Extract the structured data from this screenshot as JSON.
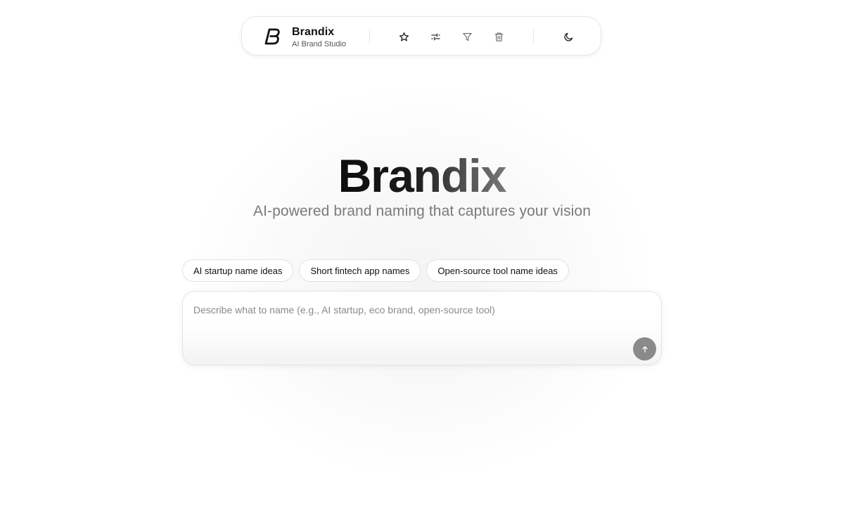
{
  "navbar": {
    "brand_name": "Brandix",
    "brand_subtitle": "AI Brand Studio",
    "logo_letter": "B",
    "icons": [
      "star-icon",
      "sliders-icon",
      "filter-icon",
      "trash-icon",
      "moon-icon"
    ]
  },
  "hero": {
    "title": "Brandix",
    "subtitle": "AI-powered brand naming that captures your vision"
  },
  "suggestions": [
    {
      "label": "AI startup name ideas"
    },
    {
      "label": "Short fintech app names"
    },
    {
      "label": "Open-source tool name ideas"
    }
  ],
  "prompt": {
    "placeholder": "Describe what to name (e.g., AI startup, eco brand, open-source tool)",
    "value": "",
    "send_icon": "arrow-up-icon"
  },
  "colors": {
    "accent": "#111111",
    "send_button": "#8a8a8a",
    "muted_text": "#7a7a7a"
  }
}
